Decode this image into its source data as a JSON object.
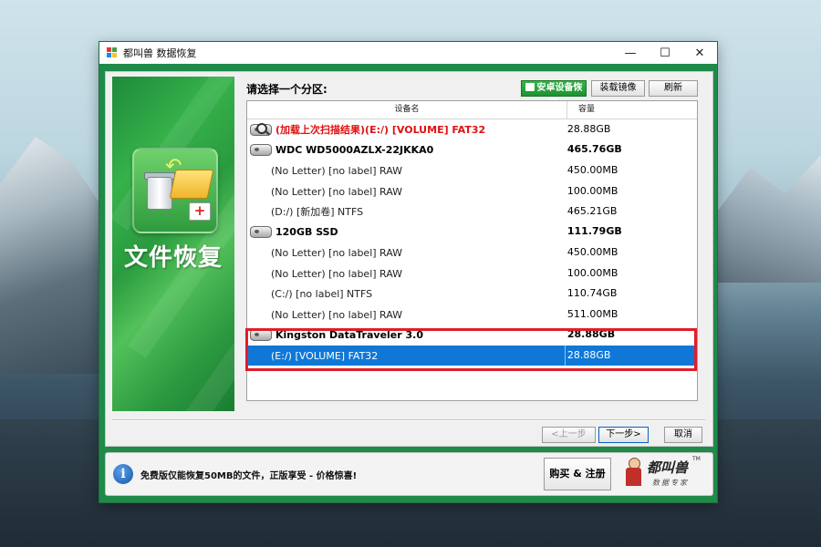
{
  "window": {
    "title": "都叫兽 数据恢复",
    "controls": {
      "minimize": "—",
      "maximize": "☐",
      "close": "✕"
    }
  },
  "banner": {
    "title": "文件恢复"
  },
  "panel": {
    "prompt": "请选择一个分区:",
    "buttons": {
      "android": "安卓设备恢复",
      "mount": "装载镜像",
      "refresh": "刷新"
    }
  },
  "table": {
    "columns": {
      "name": "设备名",
      "capacity": "容量"
    },
    "rows": [
      {
        "type": "scan",
        "name": "(加载上次扫描结果)(E:/) [VOLUME] FAT32",
        "capacity": "28.88GB"
      },
      {
        "type": "disk",
        "name": "WDC WD5000AZLX-22JKKA0",
        "capacity": "465.76GB"
      },
      {
        "type": "part",
        "name": "(No Letter) [no label] RAW",
        "capacity": "450.00MB"
      },
      {
        "type": "part",
        "name": "(No Letter) [no label] RAW",
        "capacity": "100.00MB"
      },
      {
        "type": "part",
        "name": "(D:/) [新加卷] NTFS",
        "capacity": "465.21GB"
      },
      {
        "type": "disk",
        "name": "120GB SSD",
        "capacity": "111.79GB"
      },
      {
        "type": "part",
        "name": "(No Letter) [no label] RAW",
        "capacity": "450.00MB"
      },
      {
        "type": "part",
        "name": "(No Letter) [no label] RAW",
        "capacity": "100.00MB"
      },
      {
        "type": "part",
        "name": "(C:/) [no label] NTFS",
        "capacity": "110.74GB"
      },
      {
        "type": "part",
        "name": "(No Letter) [no label] RAW",
        "capacity": "511.00MB"
      },
      {
        "type": "disk",
        "name": "Kingston DataTraveler 3.0",
        "capacity": "28.88GB"
      },
      {
        "type": "part",
        "name": "(E:/) [VOLUME] FAT32",
        "capacity": "28.88GB",
        "selected": true
      }
    ]
  },
  "nav": {
    "prev": "<上一步",
    "next": "下一步>",
    "cancel": "取消"
  },
  "footer": {
    "message": "免费版仅能恢复50MB的文件，正版享受 - 价格惊喜!",
    "buy": "购买 & 注册",
    "logo": {
      "brand": "都叫兽",
      "tm": "TM",
      "slogan": "数据专家"
    }
  },
  "colors": {
    "accent_green": "#1f8a4a",
    "selection_blue": "#0f78d7",
    "highlight_red": "#e21c2a",
    "scan_red": "#e01010"
  }
}
